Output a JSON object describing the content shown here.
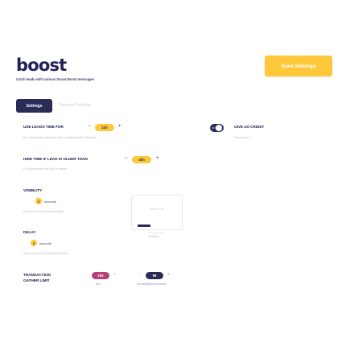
{
  "header": {
    "logo": "boost",
    "tagline": "Catch leads with various Social Boost messages",
    "save_label": "Save Settings"
  },
  "tabs": {
    "settings": "Settings",
    "restore": "Restore Defaults"
  },
  "use_leads": {
    "label": "USE LEADS TIME FOR",
    "minus": "−",
    "value": "24h",
    "plus": "+",
    "hint": "For older leads exact time will be replaced with \"recently\""
  },
  "hide_time": {
    "label": "HIDE TIME IF LEAD IS OLDER THAN",
    "minus": "−",
    "value": "48h",
    "plus": "+",
    "hint": "For older leads time will be hidden"
  },
  "give_credit": {
    "label": "GIVE US CREDIT",
    "hint": "Thank you :)",
    "toggle_text": "ON"
  },
  "visibility": {
    "label": "VISIBILITY",
    "value": "6",
    "unit": "seconds",
    "hint": "Duration of each Boost visibility"
  },
  "delay": {
    "label": "DELAY",
    "value": "3",
    "unit": "seconds",
    "hint": "Approximate time between Boosts"
  },
  "transaction": {
    "label_line1": "TRANSACTION",
    "label_line2": "GATHER LIMIT",
    "pink_minus": "−",
    "pink_value": "100",
    "pink_plus": "+",
    "pink_caption": "limit",
    "navy_minus": "−",
    "navy_value": "99",
    "navy_plus": "+",
    "navy_caption": "DoubleRight&Cent/leads"
  },
  "preview": {
    "text": "Bottom Left",
    "caption": "Position"
  },
  "colors": {
    "accent_yellow": "#ffc83a",
    "navy": "#2a2c57",
    "pink": "#b7427a"
  }
}
